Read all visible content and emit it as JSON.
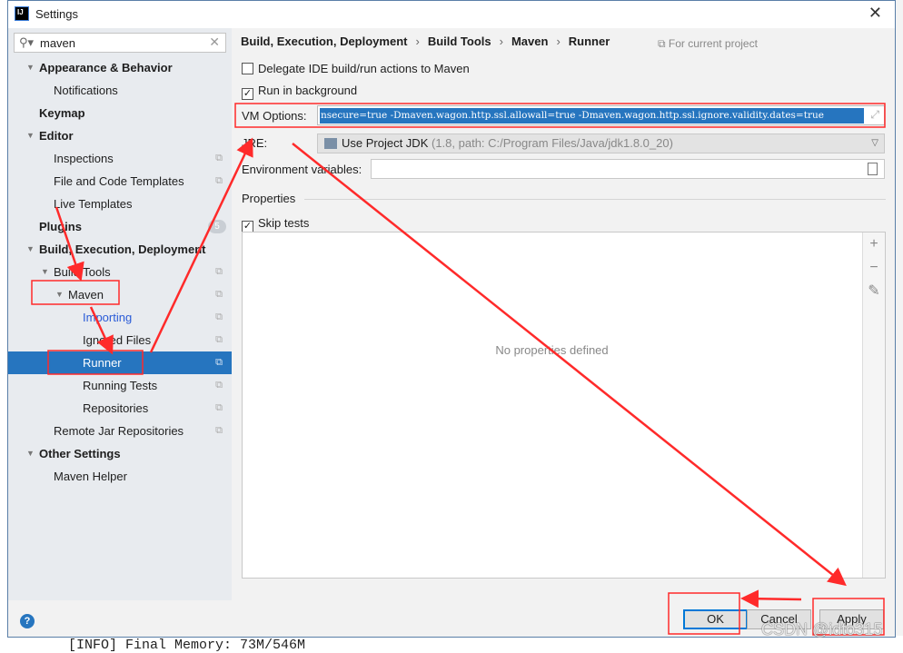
{
  "background": {
    "console_line": "[INFO] Final Memory: 73M/546M"
  },
  "window": {
    "title": "Settings",
    "app_icon": "IJ"
  },
  "search": {
    "value": "maven"
  },
  "tree": [
    {
      "label": "Appearance & Behavior",
      "level": 0,
      "bold": true,
      "expanded": true
    },
    {
      "label": "Notifications",
      "level": 1
    },
    {
      "label": "Keymap",
      "level": 0,
      "bold": true
    },
    {
      "label": "Editor",
      "level": 0,
      "bold": true,
      "expanded": true
    },
    {
      "label": "Inspections",
      "level": 1,
      "copy": true
    },
    {
      "label": "File and Code Templates",
      "level": 1,
      "copy": true
    },
    {
      "label": "Live Templates",
      "level": 1
    },
    {
      "label": "Plugins",
      "level": 0,
      "bold": true,
      "badge": "5"
    },
    {
      "label": "Build, Execution, Deployment",
      "level": 0,
      "bold": true,
      "expanded": true
    },
    {
      "label": "Build Tools",
      "level": 1,
      "expanded": true,
      "copy": true
    },
    {
      "label": "Maven",
      "level": 2,
      "expanded": true,
      "copy": true
    },
    {
      "label": "Importing",
      "level": 3,
      "copy": true,
      "link": true
    },
    {
      "label": "Ignored Files",
      "level": 3,
      "copy": true
    },
    {
      "label": "Runner",
      "level": 3,
      "copy": true,
      "selected": true
    },
    {
      "label": "Running Tests",
      "level": 3,
      "copy": true
    },
    {
      "label": "Repositories",
      "level": 3,
      "copy": true
    },
    {
      "label": "Remote Jar Repositories",
      "level": 1,
      "copy": true
    },
    {
      "label": "Other Settings",
      "level": 0,
      "bold": true,
      "expanded": true
    },
    {
      "label": "Maven Helper",
      "level": 1
    }
  ],
  "breadcrumb": [
    "Build, Execution, Deployment",
    "Build Tools",
    "Maven",
    "Runner"
  ],
  "scope": "For current project",
  "runner": {
    "delegate_label": "Delegate IDE build/run actions to Maven",
    "delegate_checked": false,
    "background_label": "Run in background",
    "background_checked": true,
    "vm_label": "VM Options:",
    "vm_value": "nsecure=true -Dmaven.wagon.http.ssl.allowall=true -Dmaven.wagon.http.ssl.ignore.validity.dates=true",
    "jre_label": "JRE:",
    "jre_value": "Use Project JDK",
    "jre_detail": "(1.8, path: C:/Program Files/Java/jdk1.8.0_20)",
    "env_label": "Environment variables:",
    "env_value": "",
    "properties_title": "Properties",
    "skip_tests_label": "Skip tests",
    "skip_tests_checked": true,
    "empty_text": "No properties defined"
  },
  "buttons": {
    "help": "?",
    "ok": "OK",
    "cancel": "Cancel",
    "apply": "Apply"
  },
  "watermark": "CSDN @idto315",
  "annotation_color": "#ff2a2a"
}
